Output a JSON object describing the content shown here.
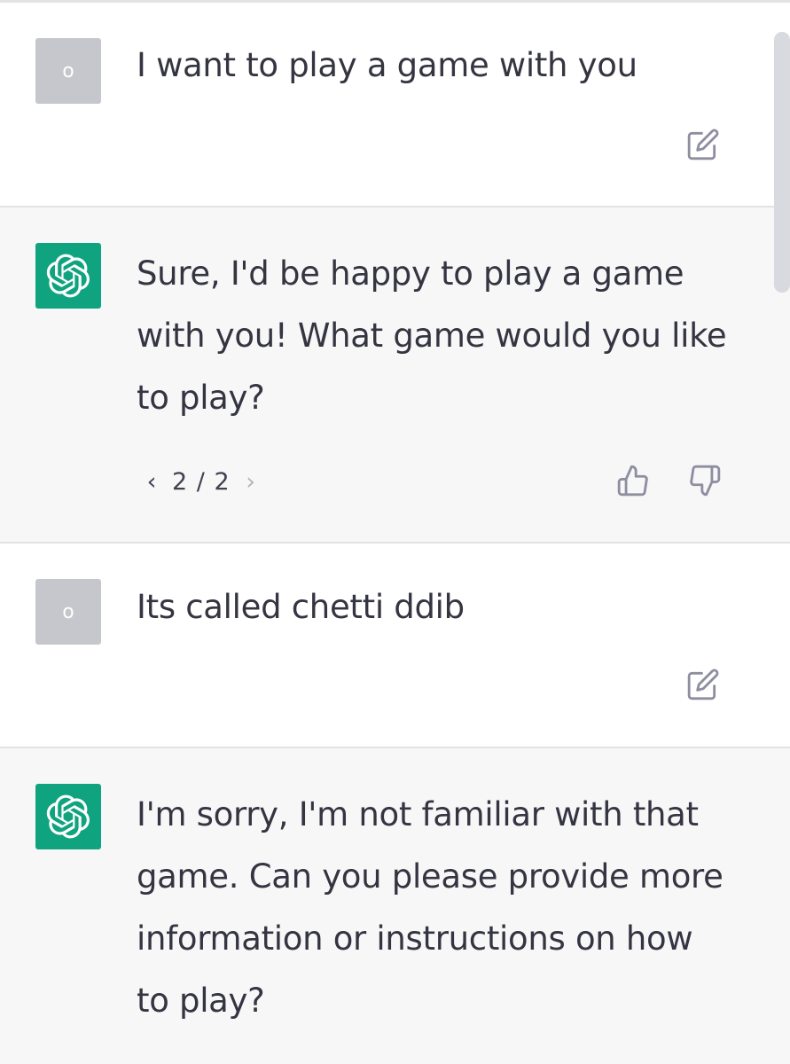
{
  "conversation": [
    {
      "role": "user",
      "avatar_letter": "o",
      "text": "I want to play a game with you",
      "action_icon": "edit-icon"
    },
    {
      "role": "assistant",
      "avatar_icon": "openai-logo-icon",
      "lines": [
        "Sure, I'd be happy to play a game",
        "with you! What game would you like",
        "to play?"
      ],
      "pager": {
        "prev": "‹",
        "count": "2 / 2",
        "next": "›"
      },
      "action_icons": [
        "thumbs-up-icon",
        "thumbs-down-icon"
      ]
    },
    {
      "role": "user",
      "avatar_letter": "o",
      "text": "Its called chetti ddib",
      "action_icon": "edit-icon"
    },
    {
      "role": "assistant",
      "avatar_icon": "openai-logo-icon",
      "lines": [
        "I'm sorry, I'm not familiar with that",
        "game. Can you please provide more",
        "information or instructions on how",
        "to play?"
      ]
    }
  ],
  "colors": {
    "user_bg": "#ffffff",
    "assistant_bg": "#f7f7f8",
    "brand_green": "#10a37f",
    "avatar_gray": "#c5c7cc",
    "text": "#343541"
  }
}
